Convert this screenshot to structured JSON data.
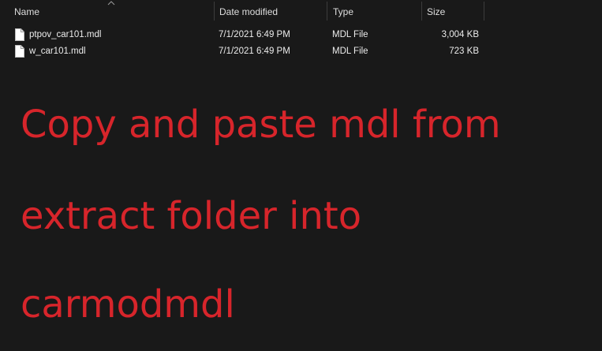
{
  "columns": {
    "name": "Name",
    "date_modified": "Date modified",
    "type": "Type",
    "size": "Size"
  },
  "sort": {
    "column": "name",
    "icon": "chevron-up-icon"
  },
  "files": [
    {
      "name": "ptpov_car101.mdl",
      "date_modified": "7/1/2021 6:49 PM",
      "type": "MDL File",
      "size": "3,004 KB",
      "icon": "file-icon"
    },
    {
      "name": "w_car101.mdl",
      "date_modified": "7/1/2021 6:49 PM",
      "type": "MDL File",
      "size": "723 KB",
      "icon": "file-icon"
    }
  ],
  "overlay": {
    "line1": "Copy and paste mdl from",
    "line2": "extract folder into",
    "line3": "carmodmdl"
  },
  "colors": {
    "background": "#191919",
    "overlay_text": "#d7252b",
    "header_text": "#dedede",
    "row_text": "#ececec"
  }
}
